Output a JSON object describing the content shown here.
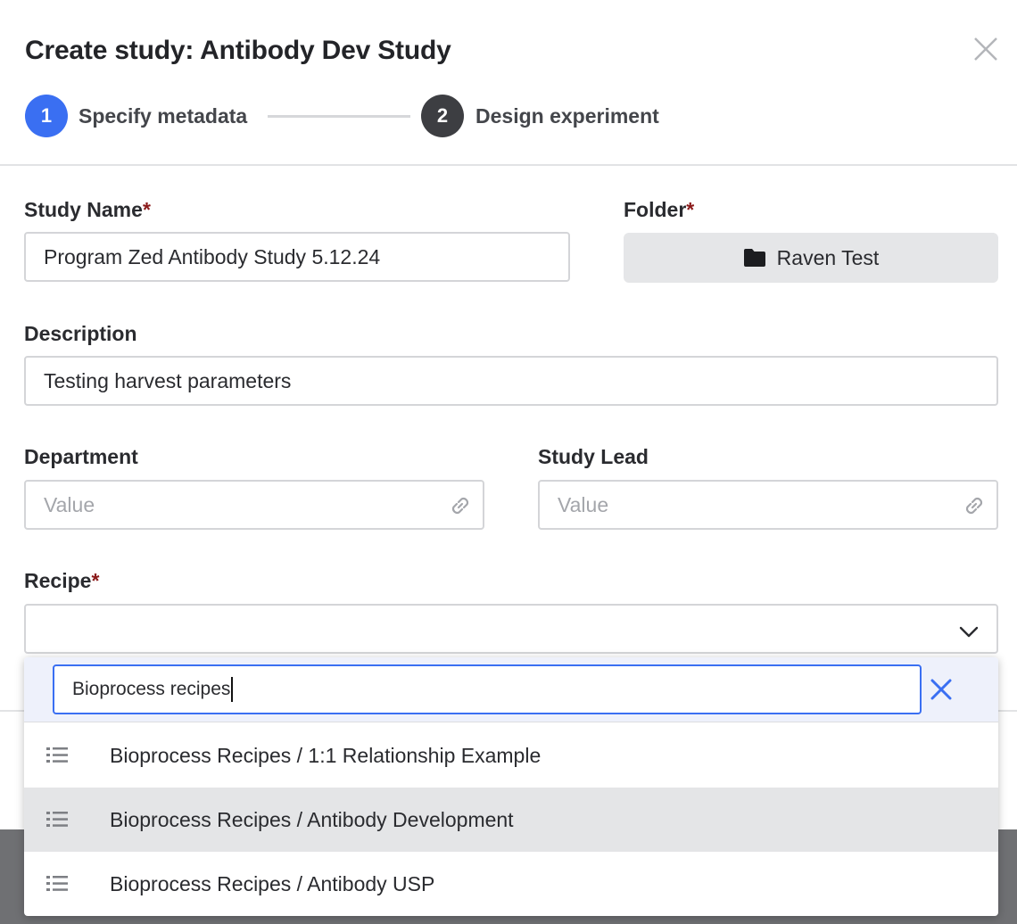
{
  "modal": {
    "title": "Create study: Antibody Dev Study",
    "close_icon": "close-icon"
  },
  "stepper": {
    "steps": [
      {
        "number": "1",
        "label": "Specify metadata",
        "state": "active",
        "color": "#3a6ff2"
      },
      {
        "number": "2",
        "label": "Design experiment",
        "state": "upcoming",
        "color": "#3d3e42"
      }
    ]
  },
  "form": {
    "study_name": {
      "label": "Study Name",
      "required_mark": "*",
      "value": "Program Zed Antibody Study 5.12.24"
    },
    "folder": {
      "label": "Folder",
      "required_mark": "*",
      "value": "Raven Test",
      "icon": "folder-icon"
    },
    "description": {
      "label": "Description",
      "value": "Testing harvest parameters"
    },
    "department": {
      "label": "Department",
      "placeholder": "Value",
      "icon": "link-icon"
    },
    "study_lead": {
      "label": "Study Lead",
      "placeholder": "Value",
      "icon": "link-icon"
    },
    "recipe": {
      "label": "Recipe",
      "required_mark": "*",
      "value": "",
      "icon": "chevron-down-icon"
    }
  },
  "recipe_dropdown": {
    "search_value": "Bioprocess recipes",
    "clear_icon": "clear-icon",
    "options": [
      {
        "label": "Bioprocess Recipes / 1:1 Relationship Example",
        "icon": "list-icon",
        "highlighted": false
      },
      {
        "label": "Bioprocess Recipes / Antibody Development",
        "icon": "list-icon",
        "highlighted": true
      },
      {
        "label": "Bioprocess Recipes / Antibody USP",
        "icon": "list-icon",
        "highlighted": false
      }
    ]
  },
  "colors": {
    "accent": "#3a6ff2",
    "required": "#8b1a1a",
    "highlight_row": "#e4e5e7"
  }
}
